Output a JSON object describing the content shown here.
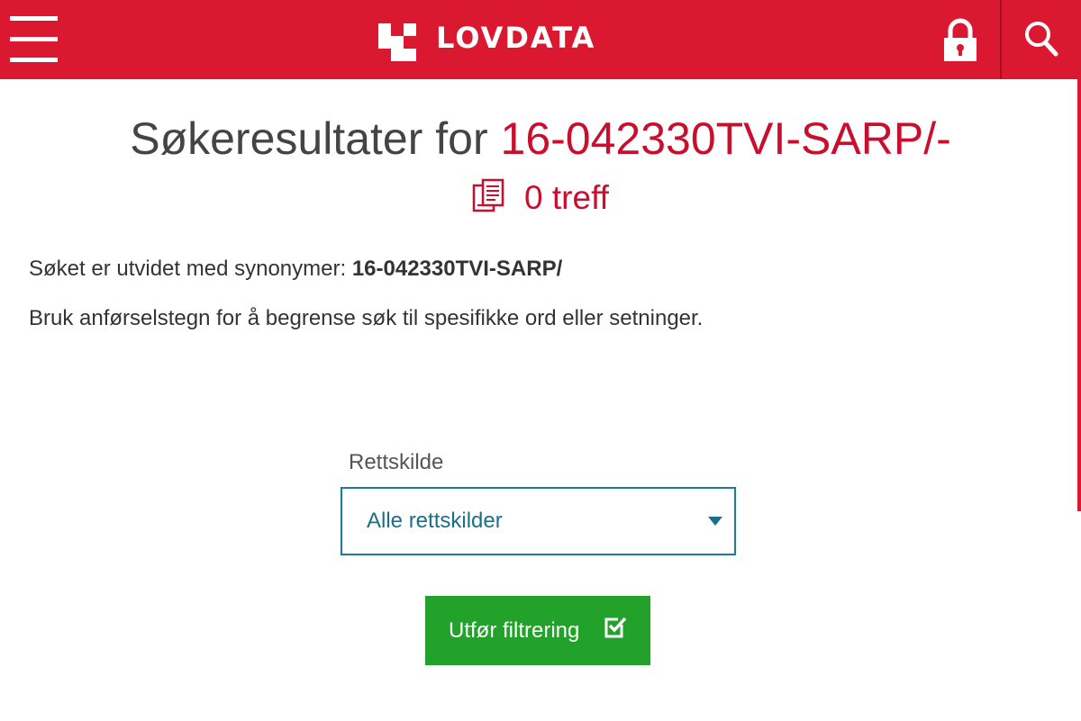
{
  "header": {
    "brand": "LOVDATA",
    "menu_icon": "hamburger-menu-icon",
    "lock_icon": "lock-icon",
    "search_icon": "search-icon",
    "color": "#da1931"
  },
  "results": {
    "title_prefix": "Søkeresultater for",
    "query": "16-042330TVI-SARP/-",
    "hit_count_text": "0 treff",
    "hit_icon": "documents-icon"
  },
  "info": {
    "synonyms_label": "Søket er utvidet med synonymer:",
    "synonyms_value": "16-042330TVI-SARP/",
    "hint": "Bruk anførselstegn for å begrense søk til spesifikke ord eller setninger."
  },
  "filter": {
    "label": "Rettskilde",
    "selected": "Alle rettskilder",
    "button_label": "Utfør filtrering",
    "button_icon": "checkbox-check-icon",
    "button_color": "#22a22a",
    "select_border_color": "#1c7b95"
  }
}
